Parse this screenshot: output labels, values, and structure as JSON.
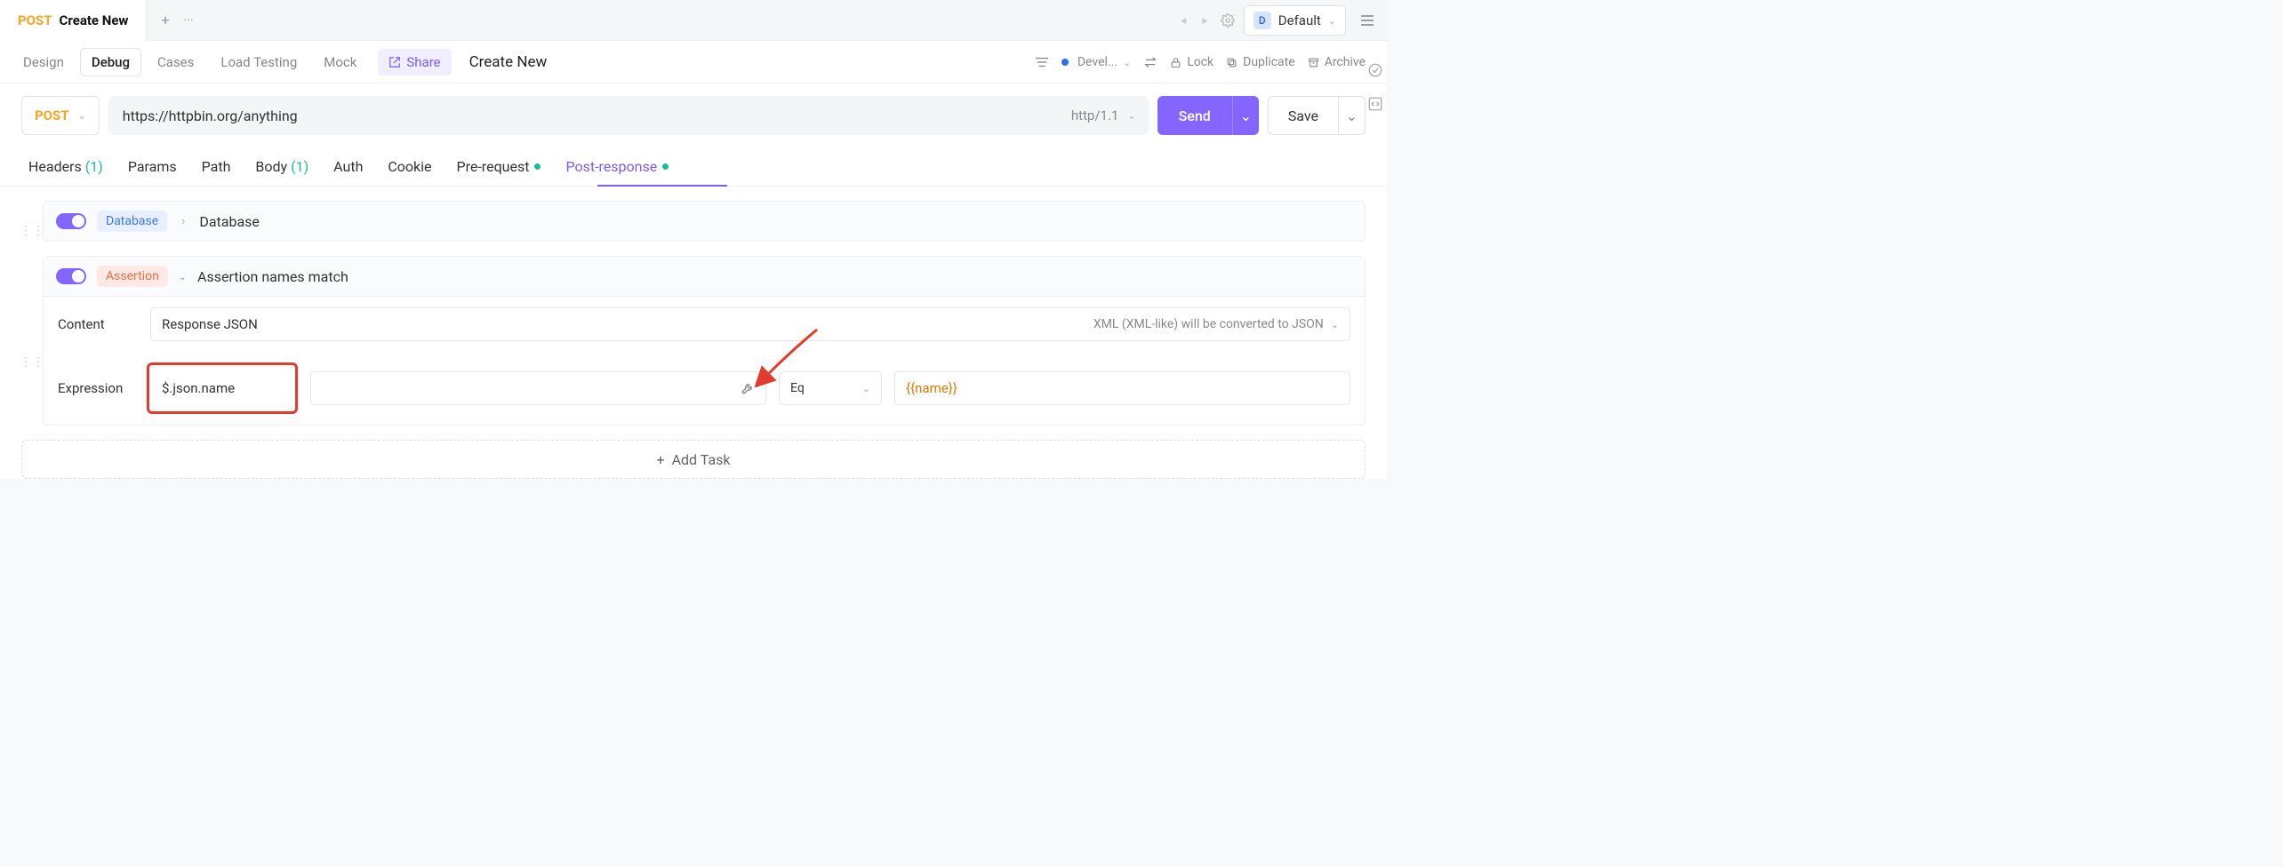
{
  "top": {
    "method": "POST",
    "title": "Create New",
    "env_letter": "D",
    "env_name": "Default"
  },
  "modes": {
    "design": "Design",
    "debug": "Debug",
    "cases": "Cases",
    "load": "Load Testing",
    "mock": "Mock",
    "share": "Share",
    "doc_name": "Create New"
  },
  "mode_right": {
    "env": "Devel...",
    "lock": "Lock",
    "dup": "Duplicate",
    "arc": "Archive"
  },
  "req": {
    "method": "POST",
    "url": "https://httpbin.org/anything",
    "protocol": "http/1.1",
    "send": "Send",
    "save": "Save"
  },
  "tabs": {
    "headers": "Headers",
    "headers_count": "(1)",
    "params": "Params",
    "path": "Path",
    "body": "Body",
    "body_count": "(1)",
    "auth": "Auth",
    "cookie": "Cookie",
    "pre": "Pre-request",
    "post": "Post-response"
  },
  "db": {
    "chip": "Database",
    "label": "Database"
  },
  "assert": {
    "chip": "Assertion",
    "title": "Assertion names match",
    "content_label": "Content",
    "content_value": "Response JSON",
    "content_hint": "XML (XML-like) will be converted to JSON",
    "expr_label": "Expression",
    "expr_value": "$.json.name",
    "op": "Eq",
    "val": "{{name}}"
  },
  "addtask": "Add Task"
}
